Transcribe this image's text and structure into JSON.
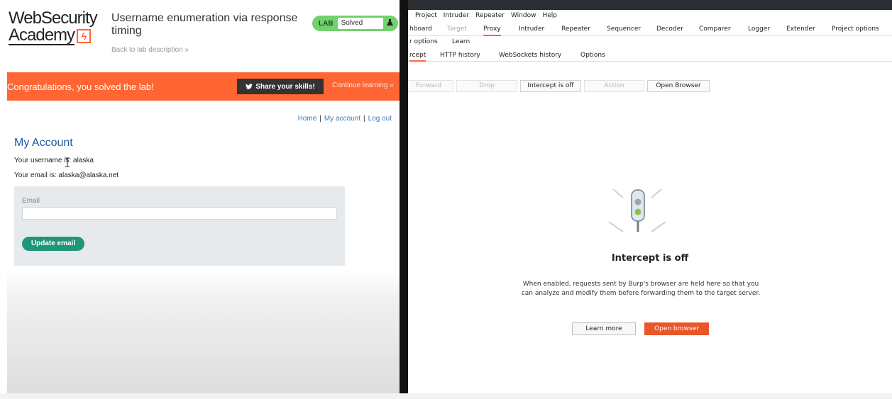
{
  "academy": {
    "logo_line1": "WebSecurity",
    "logo_line2": "Academy",
    "logo_bolt": "ϟ",
    "lab_title": "Username enumeration via response timing",
    "back_link": "Back to lab description »",
    "status": {
      "badge": "LAB",
      "text": "Solved",
      "icon": "flask-icon"
    },
    "banner": {
      "text": "Congratulations, you solved the lab!",
      "share_label": "Share your skills!",
      "continue_label": "Continue learning »"
    },
    "nav": [
      "Home",
      "My account",
      "Log out"
    ],
    "page_heading": "My Account",
    "username_line": "Your username is: alaska",
    "email_line": "Your email is: alaska@alaska.net",
    "form": {
      "email_label": "Email",
      "email_value": "",
      "submit_label": "Update email"
    }
  },
  "burp": {
    "menu": [
      "Project",
      "Intruder",
      "Repeater",
      "Window",
      "Help"
    ],
    "tabs_main": [
      {
        "label": "hboard",
        "state": "normal"
      },
      {
        "label": "Target",
        "state": "dim"
      },
      {
        "label": "Proxy",
        "state": "active"
      },
      {
        "label": "Intruder",
        "state": "normal"
      },
      {
        "label": "Repeater",
        "state": "normal"
      },
      {
        "label": "Sequencer",
        "state": "normal"
      },
      {
        "label": "Decoder",
        "state": "normal"
      },
      {
        "label": "Comparer",
        "state": "normal"
      },
      {
        "label": "Logger",
        "state": "normal"
      },
      {
        "label": "Extender",
        "state": "normal"
      },
      {
        "label": "Project options",
        "state": "normal"
      }
    ],
    "tabs_row2": [
      "r options",
      "Learn"
    ],
    "tabs_proxy": [
      "rcept",
      "HTTP history",
      "WebSockets history",
      "Options"
    ],
    "toolbar": {
      "forward": "Forward",
      "drop": "Drop",
      "intercept_toggle": "Intercept is off",
      "action": "Action",
      "open_browser": "Open Browser"
    },
    "empty_state": {
      "title": "Intercept is off",
      "description": "When enabled, requests sent by Burp's browser are held here so that you can analyze and modify them before forwarding them to the target server.",
      "learn_more": "Learn more",
      "open_browser": "Open browser"
    }
  },
  "colors": {
    "banner": "#ff6633",
    "burp_accent": "#e8562a",
    "academy_link": "#3b7bbf",
    "update_button": "#1f9579",
    "status_pill": "#70d16d"
  }
}
